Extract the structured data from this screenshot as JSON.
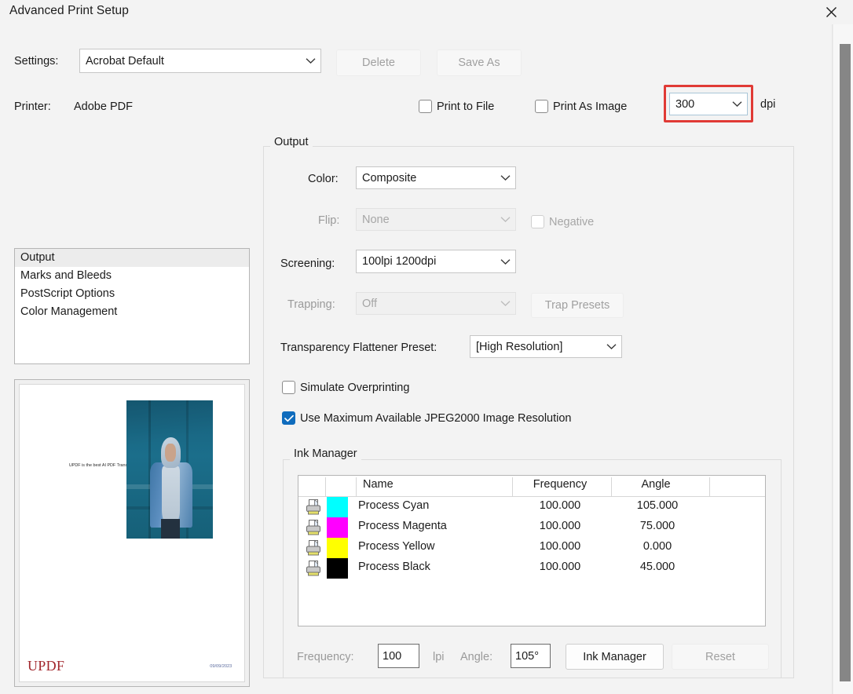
{
  "window": {
    "title": "Advanced Print Setup",
    "close_icon": "close-icon"
  },
  "settings_row": {
    "label": "Settings:",
    "value": "Acrobat Default",
    "delete_label": "Delete",
    "save_as_label": "Save As"
  },
  "printer_row": {
    "label": "Printer:",
    "value": "Adobe PDF",
    "print_to_file_label": "Print to File",
    "print_as_image_label": "Print As Image",
    "dpi_value": "300",
    "dpi_unit": "dpi",
    "highlight_color": "#e03a35"
  },
  "nav": {
    "items": [
      {
        "label": "Output",
        "selected": true
      },
      {
        "label": "Marks and Bleeds",
        "selected": false
      },
      {
        "label": "PostScript Options",
        "selected": false
      },
      {
        "label": "Color Management",
        "selected": false
      }
    ]
  },
  "preview": {
    "body_text": "UPDF is the best AI PDF Translator",
    "logo_text": "UPDF",
    "date_text": "09/09/2023"
  },
  "output": {
    "legend": "Output",
    "color_label": "Color:",
    "color_value": "Composite",
    "flip_label": "Flip:",
    "flip_value": "None",
    "negative_label": "Negative",
    "screening_label": "Screening:",
    "screening_value": "100lpi 1200dpi",
    "trapping_label": "Trapping:",
    "trapping_value": "Off",
    "trap_presets_label": "Trap Presets",
    "flattener_label": "Transparency Flattener Preset:",
    "flattener_value": "[High Resolution]",
    "simulate_overprinting_label": "Simulate Overprinting",
    "jpeg2000_label": "Use Maximum Available JPEG2000 Image Resolution"
  },
  "ink_manager": {
    "legend": "Ink Manager",
    "columns": [
      "",
      "",
      "Name",
      "Frequency",
      "Angle"
    ],
    "rows": [
      {
        "name": "Process Cyan",
        "frequency": "100.000",
        "angle": "105.000",
        "swatch": "#00ffff"
      },
      {
        "name": "Process Magenta",
        "frequency": "100.000",
        "angle": "75.000",
        "swatch": "#ff00ff"
      },
      {
        "name": "Process Yellow",
        "frequency": "100.000",
        "angle": "0.000",
        "swatch": "#ffff00"
      },
      {
        "name": "Process Black",
        "frequency": "100.000",
        "angle": "45.000",
        "swatch": "#000000"
      }
    ],
    "frequency_label": "Frequency:",
    "frequency_value": "100",
    "lpi_label": "lpi",
    "angle_label": "Angle:",
    "angle_value": "105°",
    "ink_manager_button": "Ink Manager",
    "reset_button": "Reset"
  }
}
